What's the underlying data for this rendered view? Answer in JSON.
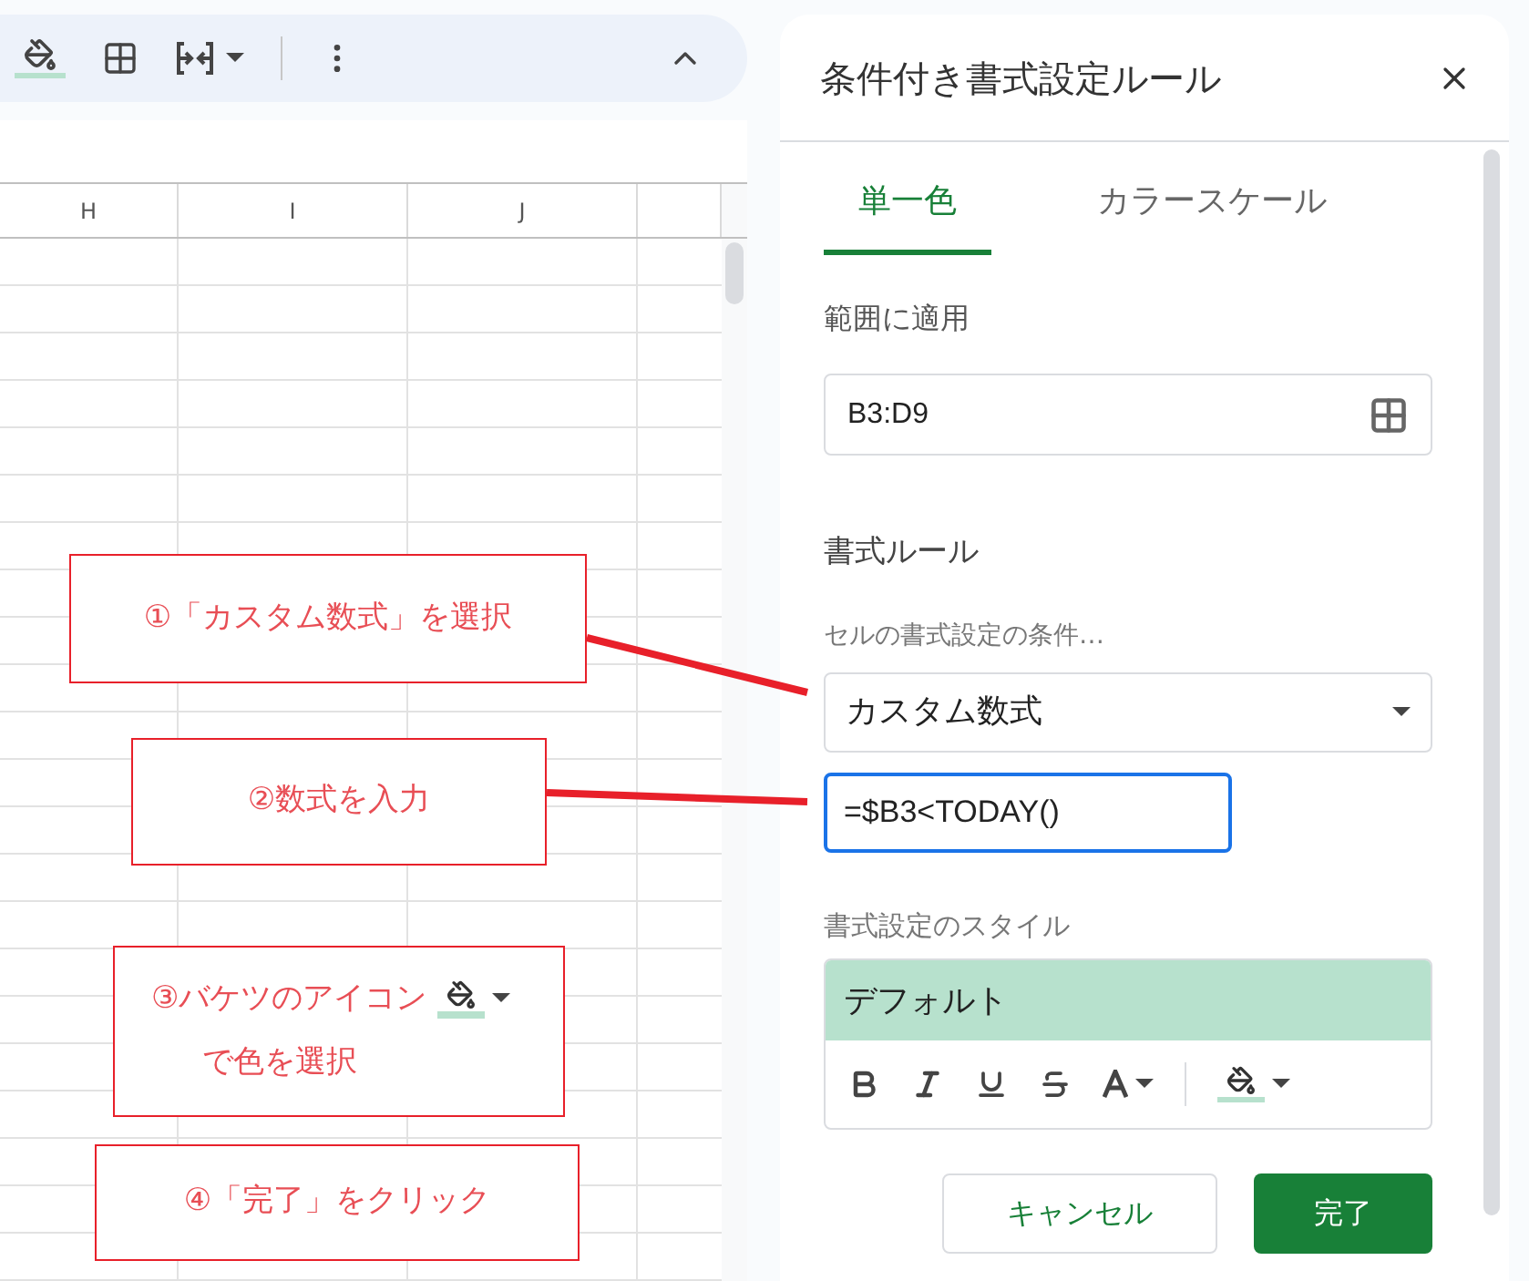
{
  "sheet": {
    "columns": [
      "H",
      "I",
      "J"
    ]
  },
  "panel": {
    "title": "条件付き書式設定ルール",
    "tabs": [
      {
        "label": "単一色",
        "selected": true
      },
      {
        "label": "カラースケール",
        "selected": false
      }
    ],
    "range_label": "範囲に適用",
    "range_value": "B3:D9",
    "rules_heading": "書式ルール",
    "condition_label": "セルの書式設定の条件…",
    "condition_value": "カスタム数式",
    "formula_value": "=$B3<TODAY()",
    "style_label": "書式設定のスタイル",
    "style_preview": "デフォルト",
    "buttons": [
      {
        "label": "キャンセル",
        "kind": "secondary"
      },
      {
        "label": "完了",
        "kind": "primary"
      }
    ]
  },
  "annotations": [
    {
      "lines": [
        "①「カスタム数式」を選択"
      ],
      "bucket_icon": false,
      "leader": true
    },
    {
      "lines": [
        "②数式を入力"
      ],
      "bucket_icon": false,
      "leader": true
    },
    {
      "lines": [
        "③バケツのアイコン",
        "で色を選択"
      ],
      "bucket_icon": true,
      "leader": false
    },
    {
      "lines": [
        "④「完了」をクリック"
      ],
      "bucket_icon": false,
      "leader": false
    }
  ]
}
